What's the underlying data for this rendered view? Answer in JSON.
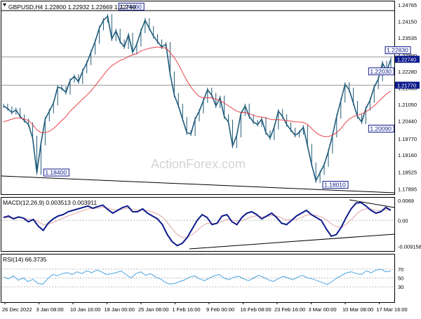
{
  "header": {
    "main_title": "GBPUSD,H4  1.22800 1.22932 1.22669 1.22740",
    "macd_title": "MACD(12,26,9) 0.003513 0.003911",
    "rsi_title": "RSI(14) 66.3735",
    "watermark": "ActionForex.com"
  },
  "colors": {
    "candle": "#1f5b7a",
    "moving_average": "#e8434a",
    "macd_line": "#0d1a8c",
    "signal_line": "#e2a6a6",
    "rsi_line": "#4aa3df",
    "label_box": "#0d1a8c",
    "price_box_bg": "#0d1a8c"
  },
  "chart_data": [
    {
      "type": "line",
      "title": "GBPUSD,H4",
      "ylim": [
        1.1775,
        1.2485
      ],
      "y_ticks": [
        "1.24765",
        "1.24150",
        "1.23535",
        "1.22890",
        "1.22280",
        "1.21665",
        "1.21050",
        "1.20440",
        "1.19770",
        "1.19160",
        "1.18525",
        "1.17895"
      ],
      "x_ticks": [
        "26 Dec 2022",
        "3 Jan 08:00",
        "10 Jan 16:00",
        "18 Jan 00:00",
        "25 Jan 08:00",
        "1 Feb 16:00",
        "9 Feb 00:00",
        "16 Feb 08:00",
        "23 Feb 16:00",
        "3 Mar 00:00",
        "10 Mar 08:00",
        "17 Mar 16:00"
      ],
      "price_tags": [
        "1.22740",
        "1.21770"
      ],
      "horizontal_lines": [
        1.2456,
        1.2283,
        1.2177
      ],
      "series": [
        {
          "values": [
            1.21,
            1.209,
            1.2075,
            1.2085,
            1.206,
            1.2045,
            1.203,
            1.198,
            1.185,
            1.196,
            1.205,
            1.208,
            1.211,
            1.217,
            1.2165,
            1.215,
            1.2195,
            1.221,
            1.219,
            1.223,
            1.226,
            1.23,
            1.234,
            1.239,
            1.242,
            1.2435,
            1.235,
            1.238,
            1.234,
            1.232,
            1.2365,
            1.23,
            1.233,
            1.238,
            1.242,
            1.239,
            1.236,
            1.234,
            1.232,
            1.233,
            1.222,
            1.214,
            1.21,
            1.205,
            1.2,
            1.1995,
            1.205,
            1.208,
            1.212,
            1.216,
            1.214,
            1.21,
            1.213,
            1.206,
            1.204,
            1.195,
            1.199,
            1.207,
            1.21,
            1.206,
            1.204,
            1.203,
            1.205,
            1.2,
            1.198,
            1.202,
            1.208,
            1.206,
            1.203,
            1.201,
            1.199,
            1.2,
            1.202,
            1.195,
            1.188,
            1.182,
            1.185,
            1.188,
            1.193,
            1.199,
            1.206,
            1.212,
            1.218,
            1.216,
            1.211,
            1.206,
            1.204,
            1.209,
            1.212,
            1.217,
            1.22,
            1.226,
            1.223,
            1.2274
          ]
        },
        {
          "values": [
            1.204,
            1.2045,
            1.205,
            1.2055,
            1.2055,
            1.205,
            1.2045,
            1.203,
            1.201,
            1.2,
            1.2,
            1.2005,
            1.2015,
            1.203,
            1.2045,
            1.206,
            1.208,
            1.2095,
            1.211,
            1.2125,
            1.214,
            1.2155,
            1.2175,
            1.2195,
            1.2215,
            1.2235,
            1.225,
            1.226,
            1.227,
            1.2275,
            1.2285,
            1.229,
            1.2295,
            1.2305,
            1.231,
            1.2315,
            1.2318,
            1.232,
            1.2318,
            1.2316,
            1.23,
            1.228,
            1.2255,
            1.2225,
            1.2195,
            1.217,
            1.215,
            1.2135,
            1.213,
            1.213,
            1.213,
            1.2125,
            1.212,
            1.211,
            1.21,
            1.209,
            1.208,
            1.2075,
            1.2075,
            1.207,
            1.2065,
            1.206,
            1.2058,
            1.2055,
            1.205,
            1.2048,
            1.2048,
            1.2047,
            1.2045,
            1.2043,
            1.204,
            1.204,
            1.2038,
            1.203,
            1.2015,
            1.2,
            1.199,
            1.1985,
            1.1985,
            1.199,
            1.2,
            1.2015,
            1.2035,
            1.205,
            1.206,
            1.2065,
            1.207,
            1.2078,
            1.2088,
            1.21,
            1.2115,
            1.213,
            1.2145,
            1.2155
          ]
        }
      ],
      "annotations": [
        {
          "text": "1.24460",
          "x": 28,
          "y": 1.2463
        },
        {
          "text": "1.18400",
          "x": 10,
          "y": 1.1843
        },
        {
          "text": "1.22030",
          "x": 88,
          "y": 1.2221
        },
        {
          "text": "1.22830",
          "x": 92,
          "y": 1.23
        },
        {
          "text": "1.20090",
          "x": 88,
          "y": 1.2007
        },
        {
          "text": "1.18010",
          "x": 77,
          "y": 1.1797
        }
      ]
    },
    {
      "type": "line",
      "title": "MACD(12,26,9)",
      "ylim": [
        -0.0102,
        0.0074
      ],
      "y_ticks": [
        "0.0069",
        "0.00",
        "-0.009158"
      ],
      "series": [
        {
          "values": [
            0.001,
            0.0015,
            0.0005,
            0.0012,
            0.0008,
            -0.0005,
            0.0003,
            -0.002,
            -0.0035,
            -0.001,
            0.0005,
            0.0015,
            0.002,
            0.003,
            0.0035,
            0.004,
            0.0045,
            0.005,
            0.0042,
            0.0048,
            0.0053,
            0.0038,
            0.0025,
            0.0035,
            0.0045,
            0.005,
            0.003,
            0.003,
            0.004,
            0.0025,
            0.0015,
            0.0005,
            -0.0015,
            -0.005,
            -0.0075,
            -0.0088,
            -0.008,
            -0.006,
            -0.003,
            0.0,
            0.002,
            0.001,
            -0.0015,
            -0.001,
            0.0015,
            0.002,
            -0.0005,
            -0.0015,
            0.001,
            0.0025,
            0.003,
            0.002,
            0.0005,
            0.0015,
            0.0025,
            0.001,
            -0.001,
            -0.0015,
            0.0,
            0.0015,
            0.0025,
            0.0035,
            0.002,
            0.001,
            0.0,
            -0.003,
            -0.0055,
            -0.005,
            -0.0025,
            0.001,
            0.004,
            0.006,
            0.0062,
            0.005,
            0.0035,
            0.0025,
            0.003,
            0.0045,
            0.0035
          ]
        },
        {
          "values": [
            0.0008,
            0.001,
            0.0009,
            0.001,
            0.0009,
            0.0004,
            0.0003,
            -0.0005,
            -0.0015,
            -0.0013,
            -0.0008,
            0.0,
            0.0008,
            0.0015,
            0.0022,
            0.0028,
            0.0034,
            0.004,
            0.0041,
            0.0043,
            0.0046,
            0.0043,
            0.0037,
            0.0036,
            0.0039,
            0.0043,
            0.0039,
            0.0036,
            0.0037,
            0.0034,
            0.0029,
            0.0022,
            0.0012,
            -0.0008,
            -0.003,
            -0.005,
            -0.006,
            -0.006,
            -0.005,
            -0.0035,
            -0.002,
            -0.001,
            -0.0011,
            -0.0011,
            -0.0004,
            0.0003,
            0.0001,
            -0.0003,
            -0.0001,
            0.0006,
            0.0013,
            0.0016,
            0.0012,
            0.0013,
            0.0017,
            0.0015,
            0.0008,
            0.0002,
            0.0001,
            0.0004,
            0.001,
            0.0018,
            0.0019,
            0.0017,
            0.0012,
            0.0002,
            -0.0012,
            -0.0022,
            -0.0024,
            -0.0014,
            0.0002,
            0.002,
            0.0035,
            0.004,
            0.0039,
            0.0035,
            0.0033,
            0.0037,
            0.0036
          ]
        }
      ]
    },
    {
      "type": "line",
      "title": "RSI(14)",
      "ylim": [
        0,
        100
      ],
      "y_ticks": [
        "70",
        "50",
        "30"
      ],
      "series": [
        {
          "values": [
            52,
            48,
            55,
            45,
            50,
            42,
            47,
            38,
            36,
            48,
            58,
            55,
            60,
            62,
            58,
            64,
            60,
            66,
            62,
            68,
            64,
            58,
            60,
            62,
            66,
            58,
            50,
            60,
            64,
            56,
            60,
            52,
            48,
            40,
            36,
            38,
            42,
            46,
            52,
            55,
            48,
            44,
            50,
            55,
            58,
            50,
            46,
            52,
            54,
            48,
            44,
            50,
            56,
            52,
            46,
            42,
            48,
            54,
            50,
            46,
            52,
            56,
            50,
            48,
            44,
            40,
            35,
            42,
            50,
            56,
            62,
            64,
            60,
            58,
            66,
            62,
            68,
            70,
            64,
            66
          ]
        }
      ]
    }
  ]
}
